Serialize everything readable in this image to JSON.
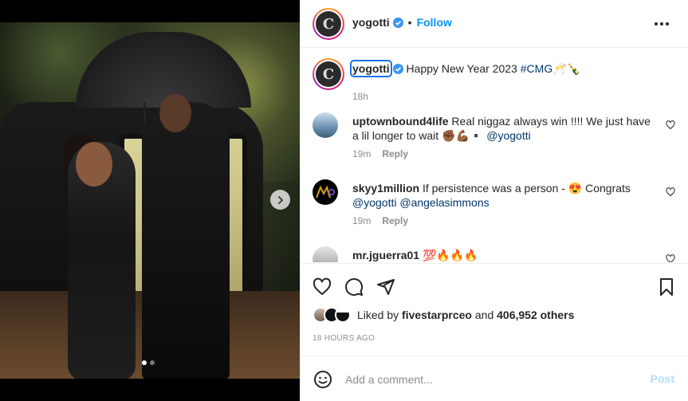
{
  "post": {
    "author": "yogotti",
    "follow_label": "Follow",
    "bullet": "•",
    "avatar_letter": "C",
    "caption": {
      "username": "yogotti",
      "text": "Happy New Year 2023",
      "hashtag": "#CMG",
      "emoji": "🥂🍾",
      "age": "18h"
    },
    "media": {
      "carousel_dots": 2,
      "active_dot": 0
    }
  },
  "comments": [
    {
      "username": "uptownbound4life",
      "text": "Real niggaz always win !!!! We just have a lil longer to wait ✊🏾💪🏾▪️",
      "mention": "@yogotti",
      "age": "19m",
      "reply_label": "Reply",
      "avatar_color": "#6b8fb0"
    },
    {
      "username": "skyy1million",
      "text_before": "If persistence was a person - 😍 Congrats",
      "mention1": "@yogotti",
      "mention2": "@angelasimmons",
      "age": "19m",
      "reply_label": "Reply",
      "avatar_color": "#000000"
    },
    {
      "username": "mr.jguerra01",
      "text": "💯🔥🔥🔥",
      "avatar_color": "#cfcfcf"
    }
  ],
  "likes": {
    "prefix": "Liked by",
    "user": "fivestarprceo",
    "conj": "and",
    "others": "406,952 others"
  },
  "timestamp": "18 HOURS AGO",
  "composer": {
    "placeholder": "Add a comment...",
    "post_label": "Post"
  },
  "colors": {
    "link_blue": "#0095f6",
    "mention": "#00376b",
    "muted": "#8e8e8e",
    "post_disabled": "#b2dffc"
  },
  "icons": {
    "more": "more-horizontal-icon",
    "like": "heart-icon",
    "comment": "comment-icon",
    "share": "send-icon",
    "save": "bookmark-icon",
    "emoji": "emoji-icon",
    "next": "chevron-right-icon",
    "verified": "verified-badge-icon"
  }
}
